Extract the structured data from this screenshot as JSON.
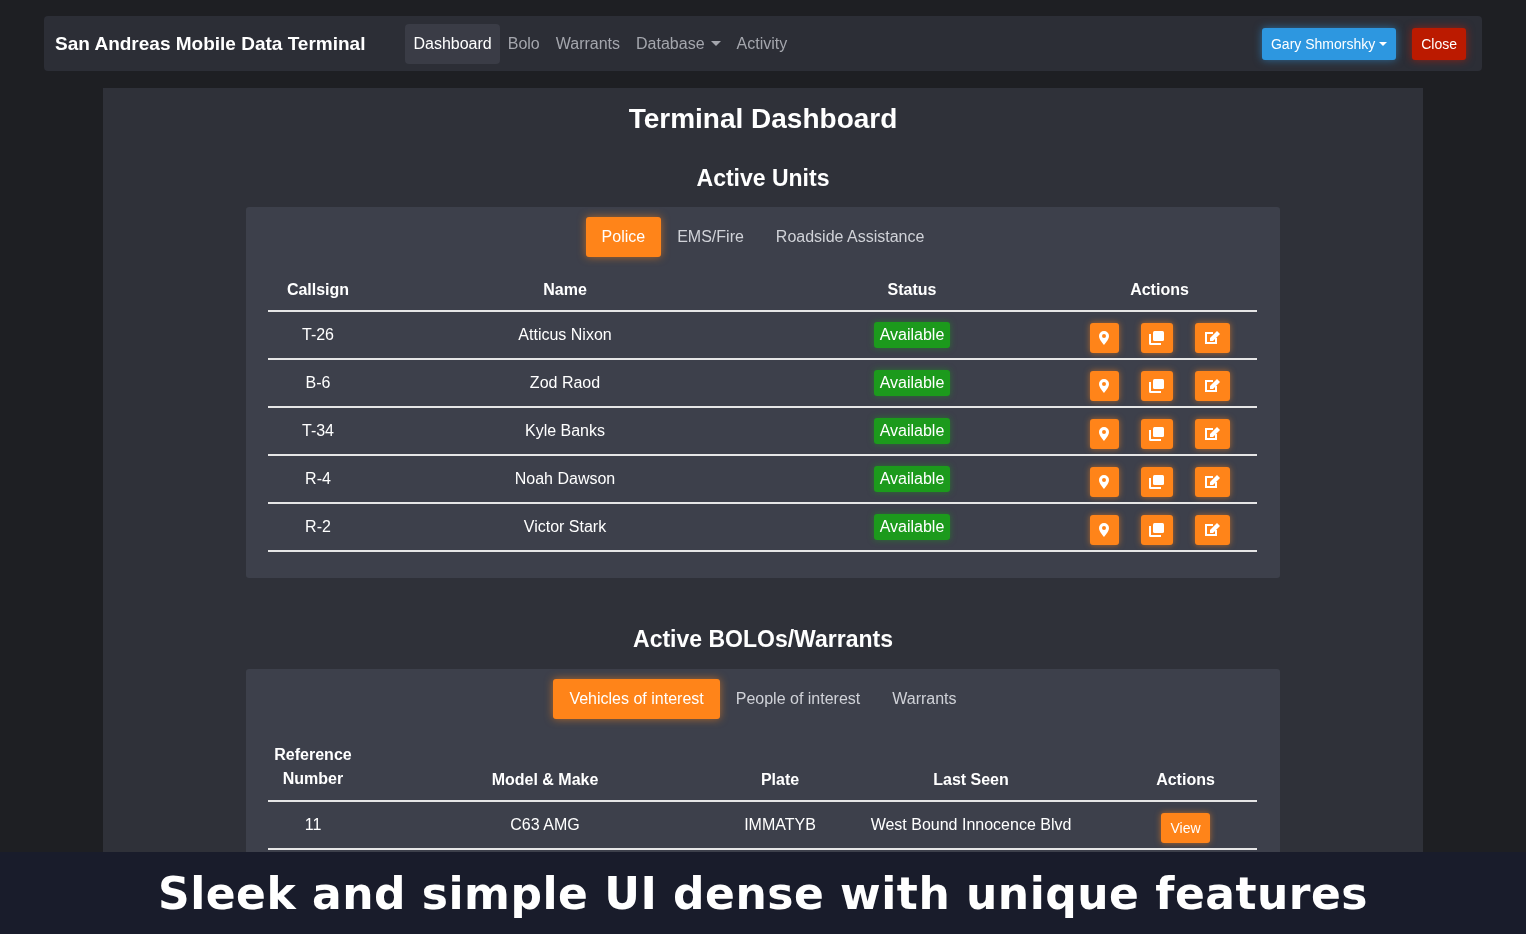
{
  "navbar": {
    "brand": "San Andreas Mobile Data Terminal",
    "links": [
      {
        "label": "Dashboard",
        "selected": true,
        "dropdown": false
      },
      {
        "label": "Bolo",
        "selected": false,
        "dropdown": false
      },
      {
        "label": "Warrants",
        "selected": false,
        "dropdown": false
      },
      {
        "label": "Database",
        "selected": false,
        "dropdown": true
      },
      {
        "label": "Activity",
        "selected": false,
        "dropdown": false
      }
    ],
    "user_button": "Gary Shmorshky",
    "close_button": "Close"
  },
  "title": "Terminal Dashboard",
  "units": {
    "heading": "Active Units",
    "tabs": [
      {
        "label": "Police",
        "selected": true
      },
      {
        "label": "EMS/Fire",
        "selected": false
      },
      {
        "label": "Roadside Assistance",
        "selected": false
      }
    ],
    "columns": [
      "Callsign",
      "Name",
      "Status",
      "Actions"
    ],
    "rows": [
      {
        "callsign": "T-26",
        "name": "Atticus Nixon",
        "status": "Available"
      },
      {
        "callsign": "B-6",
        "name": "Zod Raod",
        "status": "Available"
      },
      {
        "callsign": "T-34",
        "name": "Kyle Banks",
        "status": "Available"
      },
      {
        "callsign": "R-4",
        "name": "Noah Dawson",
        "status": "Available"
      },
      {
        "callsign": "R-2",
        "name": "Victor Stark",
        "status": "Available"
      }
    ]
  },
  "bolos": {
    "heading": "Active BOLOs/Warrants",
    "tabs": [
      {
        "label": "Vehicles of interest",
        "selected": true
      },
      {
        "label": "People of interest",
        "selected": false
      },
      {
        "label": "Warrants",
        "selected": false
      }
    ],
    "columns": [
      "Reference Number",
      "Model & Make",
      "Plate",
      "Last Seen",
      "Actions"
    ],
    "rows": [
      {
        "reference": "11",
        "model": "C63 AMG",
        "plate": "IMMATYB",
        "last_seen": "West Bound Innocence Blvd",
        "action": "View"
      }
    ]
  },
  "caption": "Sleek and simple UI dense with unique features"
}
